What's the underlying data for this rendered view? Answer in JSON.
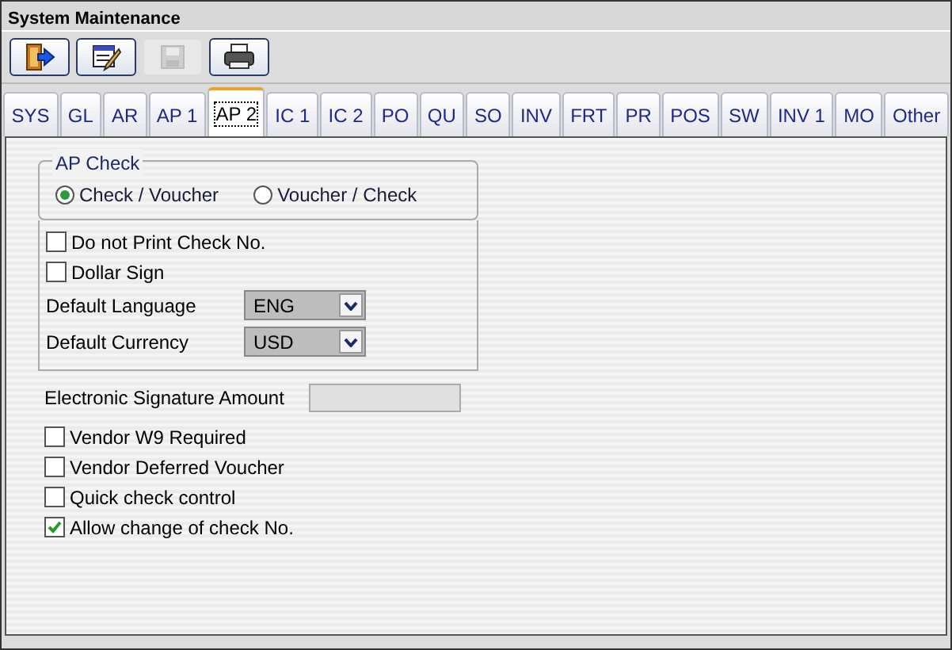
{
  "window": {
    "title": "System Maintenance"
  },
  "toolbar": [
    {
      "kind": "exit",
      "disabled": false
    },
    {
      "kind": "edit",
      "disabled": false
    },
    {
      "kind": "save",
      "disabled": true
    },
    {
      "kind": "print",
      "disabled": false
    }
  ],
  "tabs": [
    {
      "label": "SYS",
      "selected": false
    },
    {
      "label": "GL",
      "selected": false
    },
    {
      "label": "AR",
      "selected": false
    },
    {
      "label": "AP 1",
      "selected": false
    },
    {
      "label": "AP 2",
      "selected": true
    },
    {
      "label": "IC 1",
      "selected": false
    },
    {
      "label": "IC 2",
      "selected": false
    },
    {
      "label": "PO",
      "selected": false
    },
    {
      "label": "QU",
      "selected": false
    },
    {
      "label": "SO",
      "selected": false
    },
    {
      "label": "INV",
      "selected": false
    },
    {
      "label": "FRT",
      "selected": false
    },
    {
      "label": "PR",
      "selected": false
    },
    {
      "label": "POS",
      "selected": false
    },
    {
      "label": "SW",
      "selected": false
    },
    {
      "label": "INV 1",
      "selected": false
    },
    {
      "label": "MO",
      "selected": false
    },
    {
      "label": "Other",
      "selected": false
    }
  ],
  "ap_check": {
    "title": "AP Check",
    "options": [
      {
        "label": "Check / Voucher",
        "selected": true
      },
      {
        "label": "Voucher / Check",
        "selected": false
      }
    ]
  },
  "options": [
    {
      "label": "Do not Print Check No.",
      "checked": false
    },
    {
      "label": "Dollar Sign",
      "checked": false
    }
  ],
  "selects": [
    {
      "label": "Default Language",
      "value": "ENG"
    },
    {
      "label": "Default Currency",
      "value": "USD"
    }
  ],
  "signature": {
    "label": "Electronic Signature Amount"
  },
  "more_options": [
    {
      "label": "Vendor W9 Required",
      "checked": false
    },
    {
      "label": "Vendor Deferred Voucher",
      "checked": false
    },
    {
      "label": "Quick check control",
      "checked": false
    },
    {
      "label": "Allow change of check No.",
      "checked": true
    }
  ]
}
